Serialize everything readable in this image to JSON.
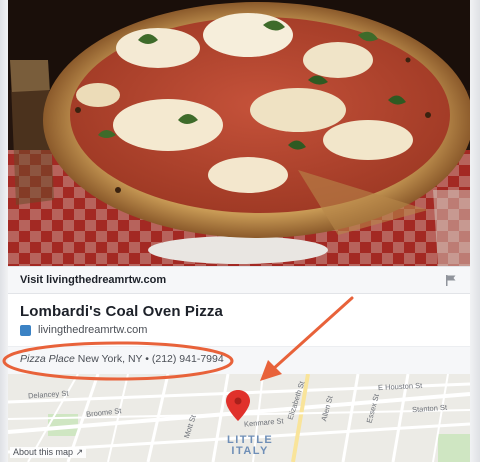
{
  "visit_bar": {
    "prefix": "Visit",
    "domain": "livingthedreamrtw.com",
    "report_icon": "flag-icon"
  },
  "place": {
    "name": "Lombardi's Coal Oven Pizza",
    "website": "livingthedreamrtw.com",
    "website_icon": "site-favicon-icon",
    "category": "Pizza Place",
    "location_phone": "New York, NY • (212) 941-7994"
  },
  "map": {
    "about_label": "About this map",
    "external_icon": "external-link-icon",
    "district_line1": "LITTLE",
    "district_line2": "ITALY",
    "streets": {
      "broome": "Broome St",
      "kenmare": "Kenmare St",
      "houston": "E Houston St",
      "elizabeth": "Elizabeth St",
      "mott": "Mott St",
      "allen": "Allen St",
      "stanton": "Stanton St",
      "essex": "Essex St",
      "delancey": "Delancey St"
    },
    "pin_icon": "map-pin-icon"
  },
  "annotation": {
    "highlight": "ellipse",
    "pointer": "arrow",
    "color": "#e8623a"
  },
  "colors": {
    "text_primary": "#1d2129",
    "text_secondary": "#4b4f56",
    "pin_red": "#e0312b",
    "district_blue": "#6f8fb7"
  }
}
